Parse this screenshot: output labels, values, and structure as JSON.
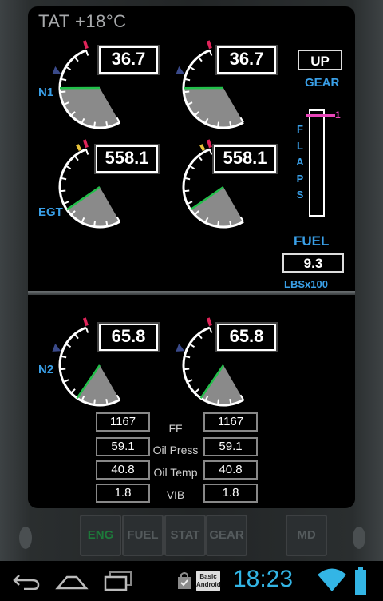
{
  "tat": "TAT +18°C",
  "labels": {
    "n1": "N1",
    "egt": "EGT",
    "n2": "N2"
  },
  "n1": [
    {
      "value": "36.7",
      "fraction": 0.37
    },
    {
      "value": "36.7",
      "fraction": 0.37
    }
  ],
  "egt": [
    {
      "value": "558.1",
      "fraction": 0.55
    },
    {
      "value": "558.1",
      "fraction": 0.55
    }
  ],
  "n2": [
    {
      "value": "65.8",
      "fraction": 0.66
    },
    {
      "value": "65.8",
      "fraction": 0.66
    }
  ],
  "gear": {
    "state": "UP",
    "label": "GEAR"
  },
  "flaps": {
    "letters": [
      "F",
      "L",
      "A",
      "P",
      "S"
    ],
    "value": "1"
  },
  "fuel": {
    "label": "FUEL",
    "value": "9.3",
    "unit": "LBSx100"
  },
  "secondary": {
    "labels": [
      "FF",
      "Oil Press",
      "Oil Temp",
      "VIB"
    ],
    "left": [
      "1167",
      "59.1",
      "40.8",
      "1.8"
    ],
    "right": [
      "1167",
      "59.1",
      "40.8",
      "1.8"
    ]
  },
  "tabs": [
    {
      "label": "ENG",
      "active": true
    },
    {
      "label": "FUEL",
      "active": false
    },
    {
      "label": "STAT",
      "active": false
    },
    {
      "label": "GEAR",
      "active": false
    },
    {
      "label": "MD",
      "active": false
    }
  ],
  "statusbar": {
    "time": "18:23",
    "app_badge": "Basic Android"
  },
  "colors": {
    "accent_blue": "#3aa0e8",
    "needle_green": "#22c04a",
    "redline": "#e0245a",
    "caution": "#e8c23a",
    "flaps_magenta": "#e845b8",
    "gauge_fill": "#8a8a8a"
  },
  "icons": [
    "back-icon",
    "home-icon",
    "recent-apps-icon",
    "shopping-bag-icon",
    "wifi-icon",
    "battery-icon"
  ]
}
